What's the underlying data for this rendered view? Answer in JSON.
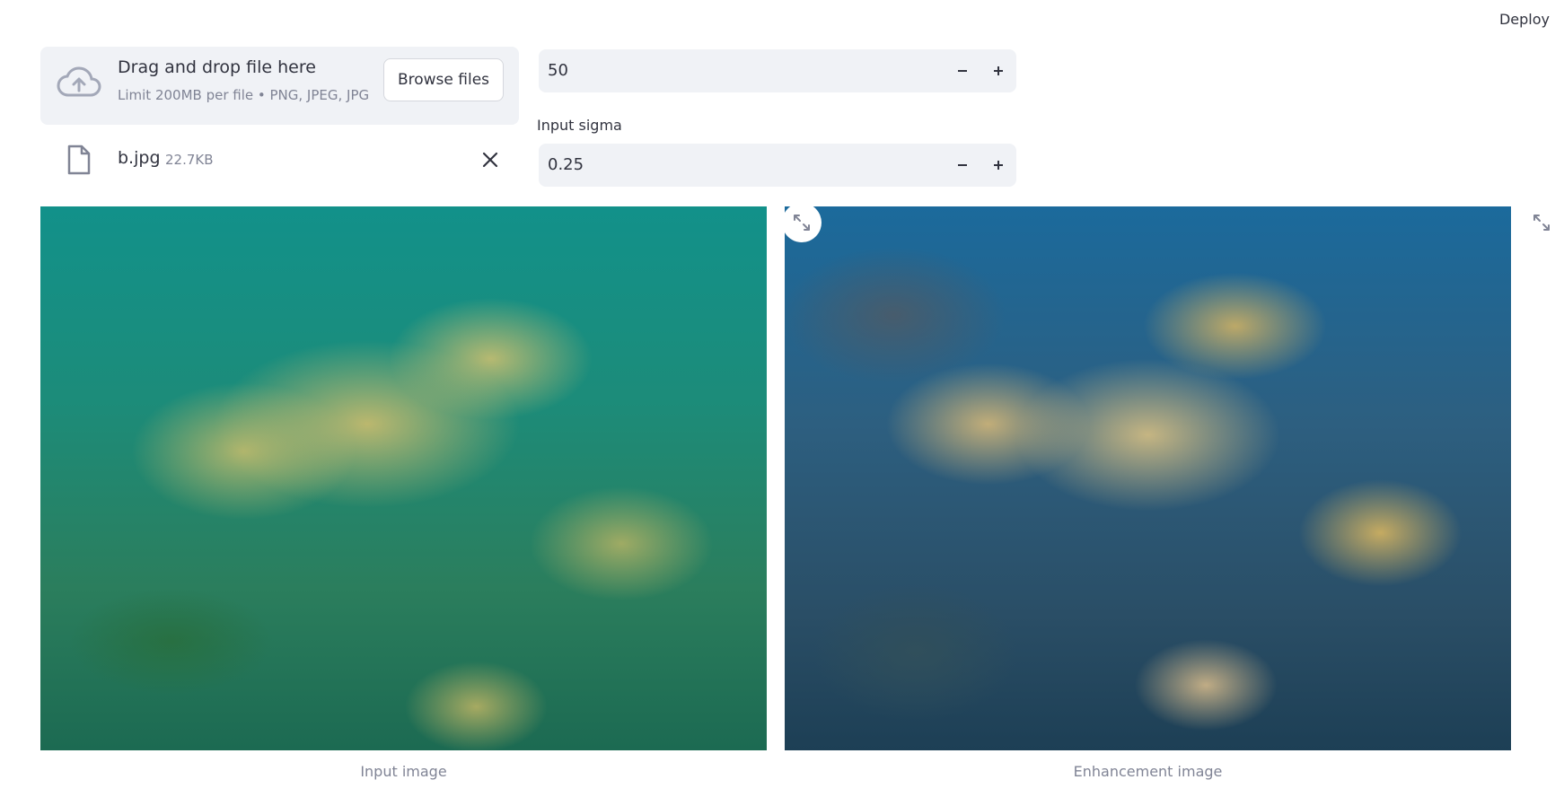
{
  "header": {
    "deploy_label": "Deploy"
  },
  "uploader": {
    "drag_text": "Drag and drop file here",
    "limit_text": "Limit 200MB per file • PNG, JPEG, JPG",
    "browse_label": "Browse files",
    "icon": "cloud-upload-icon"
  },
  "file": {
    "name": "b.jpg",
    "size": "22.7KB",
    "icon": "file-icon",
    "remove_icon": "close-icon"
  },
  "inputs": {
    "steps_value": "50",
    "sigma_label": "Input sigma",
    "sigma_value": "0.25",
    "minus_glyph": "−",
    "plus_glyph": "+"
  },
  "images": {
    "left_caption": "Input image",
    "right_caption": "Enhancement image",
    "expand_icon": "fullscreen-icon"
  },
  "colors": {
    "widget_bg": "#F0F2F6",
    "text": "#31333F",
    "muted": "#808495"
  }
}
